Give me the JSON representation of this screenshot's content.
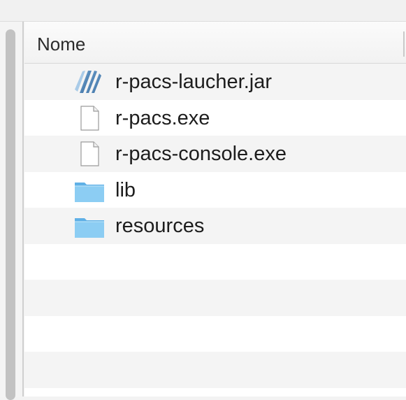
{
  "column": {
    "name_header": "Nome"
  },
  "files": [
    {
      "name": "r-pacs-laucher.jar",
      "icon": "jar-file-icon"
    },
    {
      "name": "r-pacs.exe",
      "icon": "document-icon"
    },
    {
      "name": "r-pacs-console.exe",
      "icon": "document-icon"
    },
    {
      "name": "lib",
      "icon": "folder-icon"
    },
    {
      "name": "resources",
      "icon": "folder-icon"
    }
  ],
  "colors": {
    "folder": "#7cc3ee",
    "jar": "#3a78b0",
    "row_alt": "#f4f4f4"
  }
}
